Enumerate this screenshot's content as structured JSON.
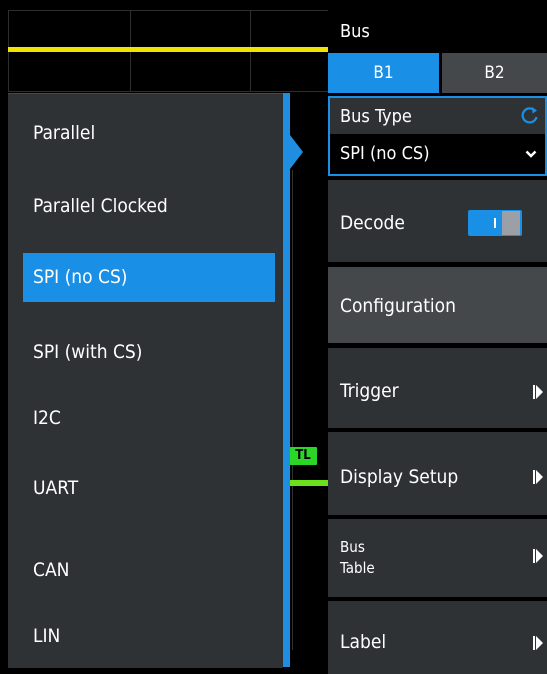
{
  "colors": {
    "accent": "#1a8fe6",
    "panel": "#2f3235",
    "trace_yellow": "#f0e400",
    "trace_green": "#6be11e"
  },
  "scope": {
    "trigger_level_marker": "TL"
  },
  "bus_type_list": {
    "items": [
      {
        "label": "Parallel",
        "selected": false
      },
      {
        "label": "Parallel Clocked",
        "selected": false
      },
      {
        "label": "SPI (no CS)",
        "selected": true
      },
      {
        "label": "SPI (with CS)",
        "selected": false
      },
      {
        "label": "I2C",
        "selected": false
      },
      {
        "label": "UART",
        "selected": false
      },
      {
        "label": "CAN",
        "selected": false
      },
      {
        "label": "LIN",
        "selected": false
      }
    ]
  },
  "menu": {
    "title": "Bus",
    "tabs": [
      {
        "label": "B1",
        "active": true
      },
      {
        "label": "B2",
        "active": false
      }
    ],
    "bus_type": {
      "label": "Bus Type",
      "value": "SPI (no CS)",
      "icon": "refresh-icon"
    },
    "decode": {
      "label": "Decode",
      "on": true
    },
    "configuration": {
      "label": "Configuration"
    },
    "trigger": {
      "label": "Trigger"
    },
    "display_setup": {
      "label": "Display Setup"
    },
    "bus_table": {
      "label_line1": "Bus",
      "label_line2": "Table"
    },
    "label": {
      "label": "Label"
    }
  }
}
